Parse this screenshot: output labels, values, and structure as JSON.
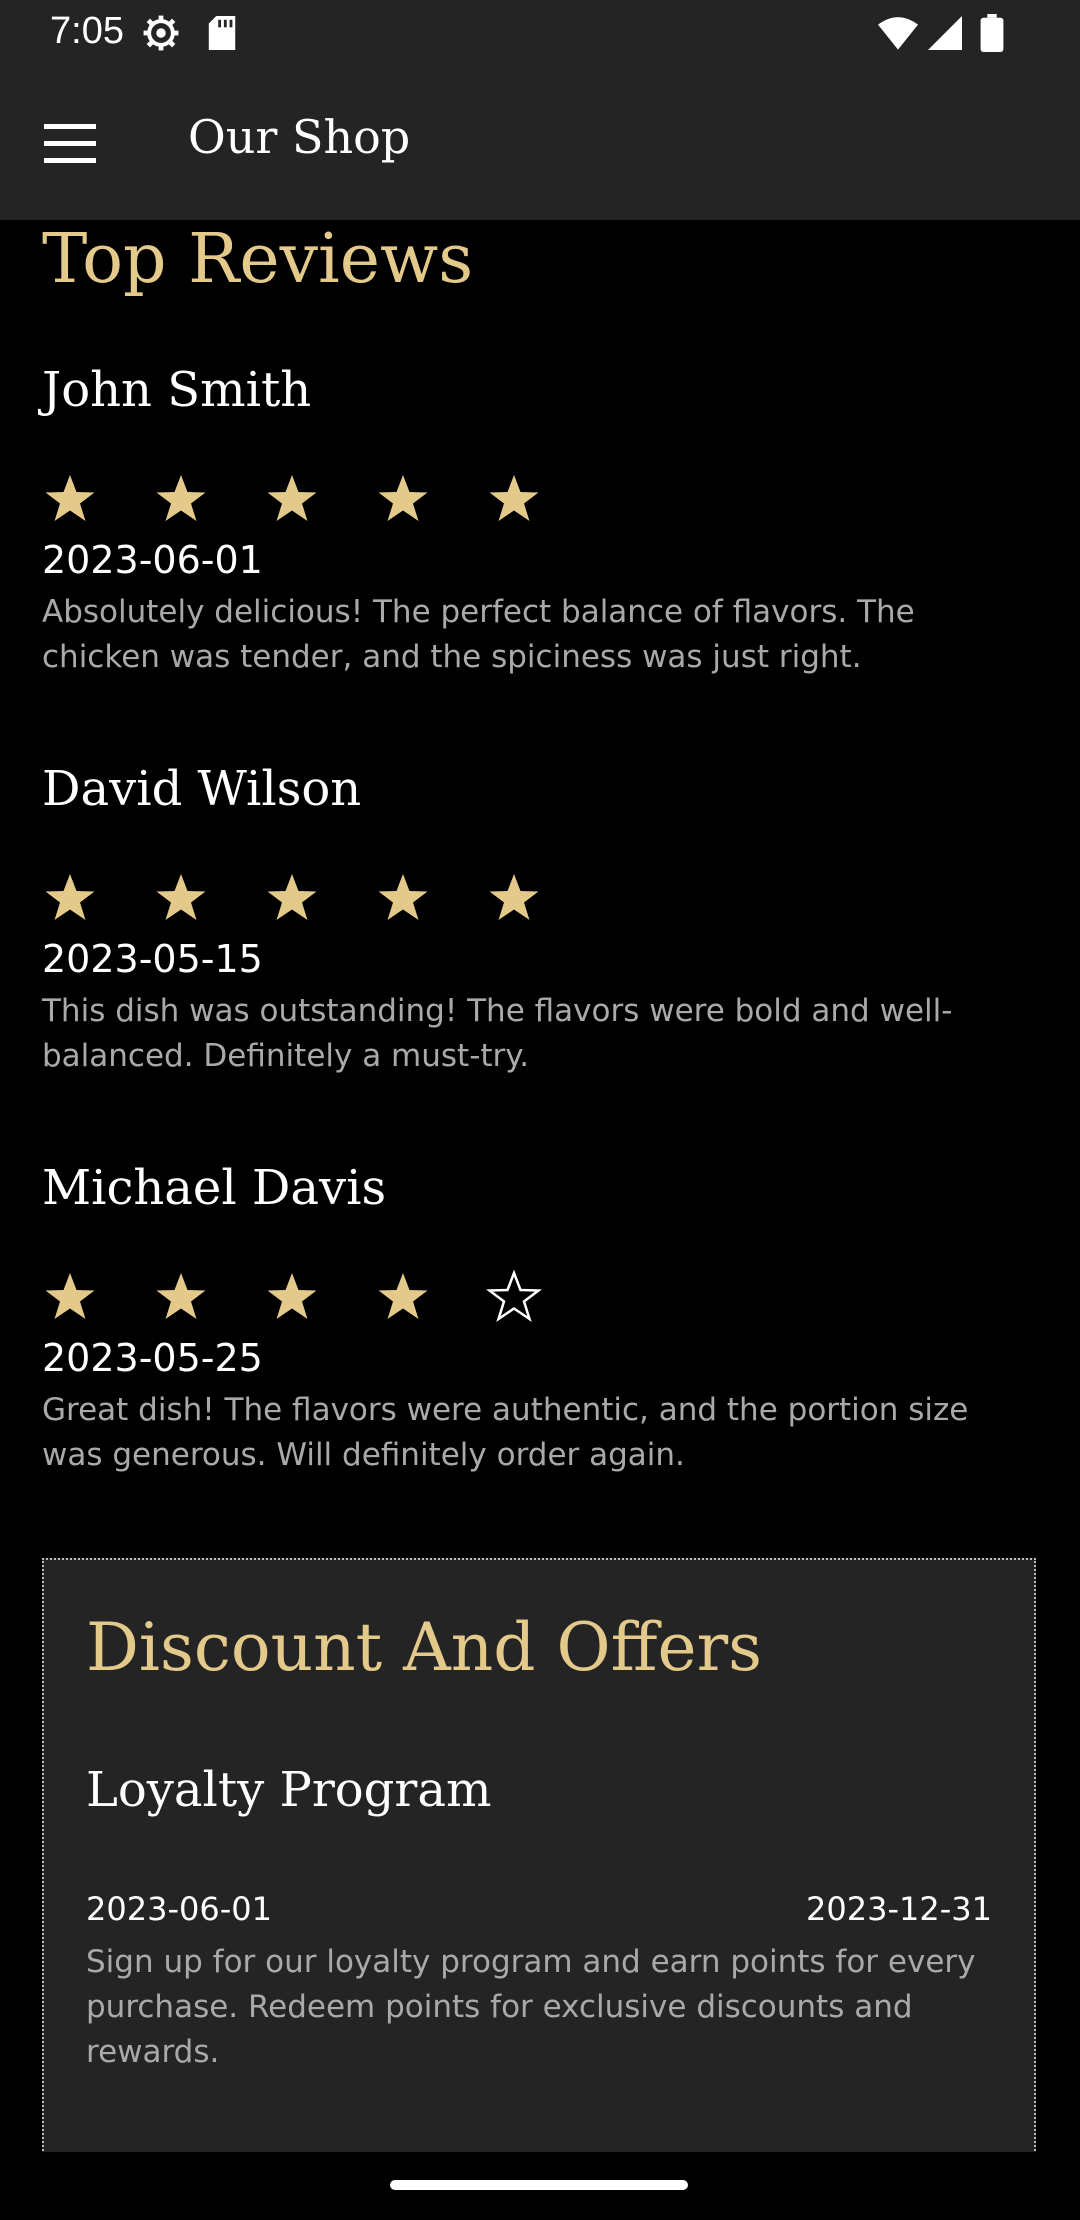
{
  "status_bar": {
    "time": "7:05",
    "icons": [
      "settings-gear-icon",
      "sd-card-icon",
      "wifi-icon",
      "signal-icon",
      "battery-icon"
    ]
  },
  "app_bar": {
    "title": "Our Shop",
    "menu_icon": "hamburger-menu-icon"
  },
  "top_reviews": {
    "title": "Top Reviews",
    "reviews": [
      {
        "name": "John Smith",
        "rating": 5,
        "max_rating": 5,
        "date": "2023-06-01",
        "text": "Absolutely delicious! The perfect balance of flavors. The chicken was tender, and the spiciness was just right."
      },
      {
        "name": "David Wilson",
        "rating": 5,
        "max_rating": 5,
        "date": "2023-05-15",
        "text": "This dish was outstanding! The flavors were bold and well-balanced. Definitely a must-try."
      },
      {
        "name": "Michael Davis",
        "rating": 4,
        "max_rating": 5,
        "date": "2023-05-25",
        "text": "Great dish! The flavors were authentic, and the portion size was generous. Will definitely order again."
      }
    ]
  },
  "discounts": {
    "title": "Discount And Offers",
    "offers": [
      {
        "name": "Loyalty Program",
        "start_date": "2023-06-01",
        "end_date": "2023-12-31",
        "description": "Sign up for our loyalty program and earn points for every purchase. Redeem points for exclusive discounts and rewards."
      }
    ]
  },
  "colors": {
    "accent_gold": "#e3c98a",
    "surface": "#242424",
    "background": "#000000",
    "muted_text": "#a9a9a9"
  }
}
